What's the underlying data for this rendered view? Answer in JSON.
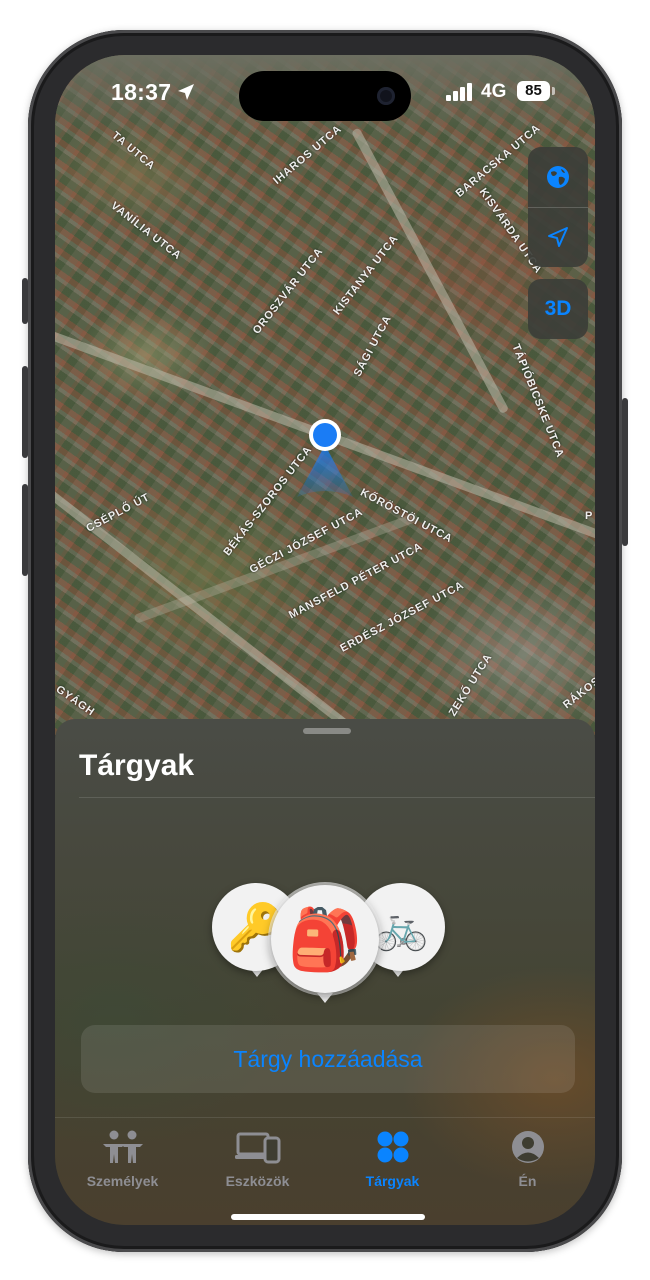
{
  "status_bar": {
    "time": "18:37",
    "network": "4G",
    "battery": "85"
  },
  "map": {
    "street_labels": [
      "TA UTCA",
      "IHAROS UTCA",
      "BARACSKA UTCA",
      "VANÍLIA UTCA",
      "KISVÁRDA UTCA",
      "OROSZVÁR UTCA",
      "KISTANYA UTCA",
      "SÁGI UTCA",
      "TÁPIÓBICSKE UTCA",
      "BÉKÁS-SZOROS UTCA",
      "KŐRÖSTÖI UTCA",
      "CSÉPLŐ ÚT",
      "GÉCZI JÓZSEF UTCA",
      "MANSFELD PÉTER UTCA",
      "ERDÉSZ JÓZSEF UTCA",
      "ZEKŐ UTCA",
      "RÁKOS",
      "GYÁGH",
      "P"
    ],
    "controls": {
      "three_d_label": "3D"
    }
  },
  "sheet": {
    "title": "Tárgyak",
    "items": [
      {
        "emoji": "🔑",
        "name": "key"
      },
      {
        "emoji": "🎒",
        "name": "backpack"
      },
      {
        "emoji": "🚲",
        "name": "bicycle"
      }
    ],
    "add_button": "Tárgy hozzáadása"
  },
  "tabs": [
    {
      "label": "Személyek",
      "active": false
    },
    {
      "label": "Eszközök",
      "active": false
    },
    {
      "label": "Tárgyak",
      "active": true
    },
    {
      "label": "Én",
      "active": false
    }
  ],
  "colors": {
    "accent": "#0a84ff",
    "inactive": "#8e8e93",
    "user_dot": "#1a7cf5"
  }
}
